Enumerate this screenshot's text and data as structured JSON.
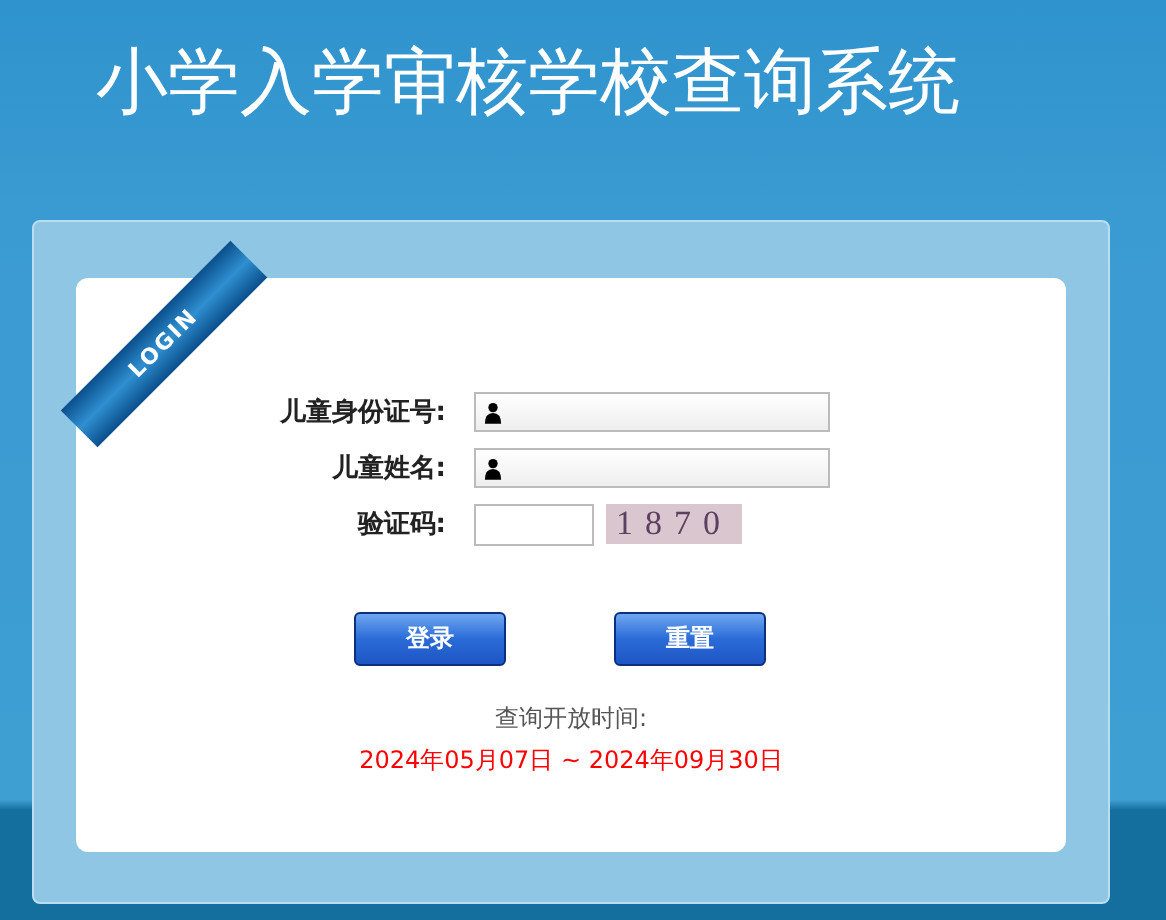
{
  "header": {
    "title": "小学入学审核学校查询系统"
  },
  "ribbon": {
    "label": "LOGIN"
  },
  "form": {
    "fields": [
      {
        "kind": "text",
        "label": "儿童身份证号:"
      },
      {
        "kind": "text",
        "label": "儿童姓名:"
      },
      {
        "kind": "captcha",
        "label": "验证码:",
        "captcha": "1870"
      }
    ],
    "buttons": [
      "登录",
      "重置"
    ]
  },
  "notice": {
    "label": "查询开放时间:",
    "period": "2024年05月07日 ~ 2024年09月30日"
  }
}
